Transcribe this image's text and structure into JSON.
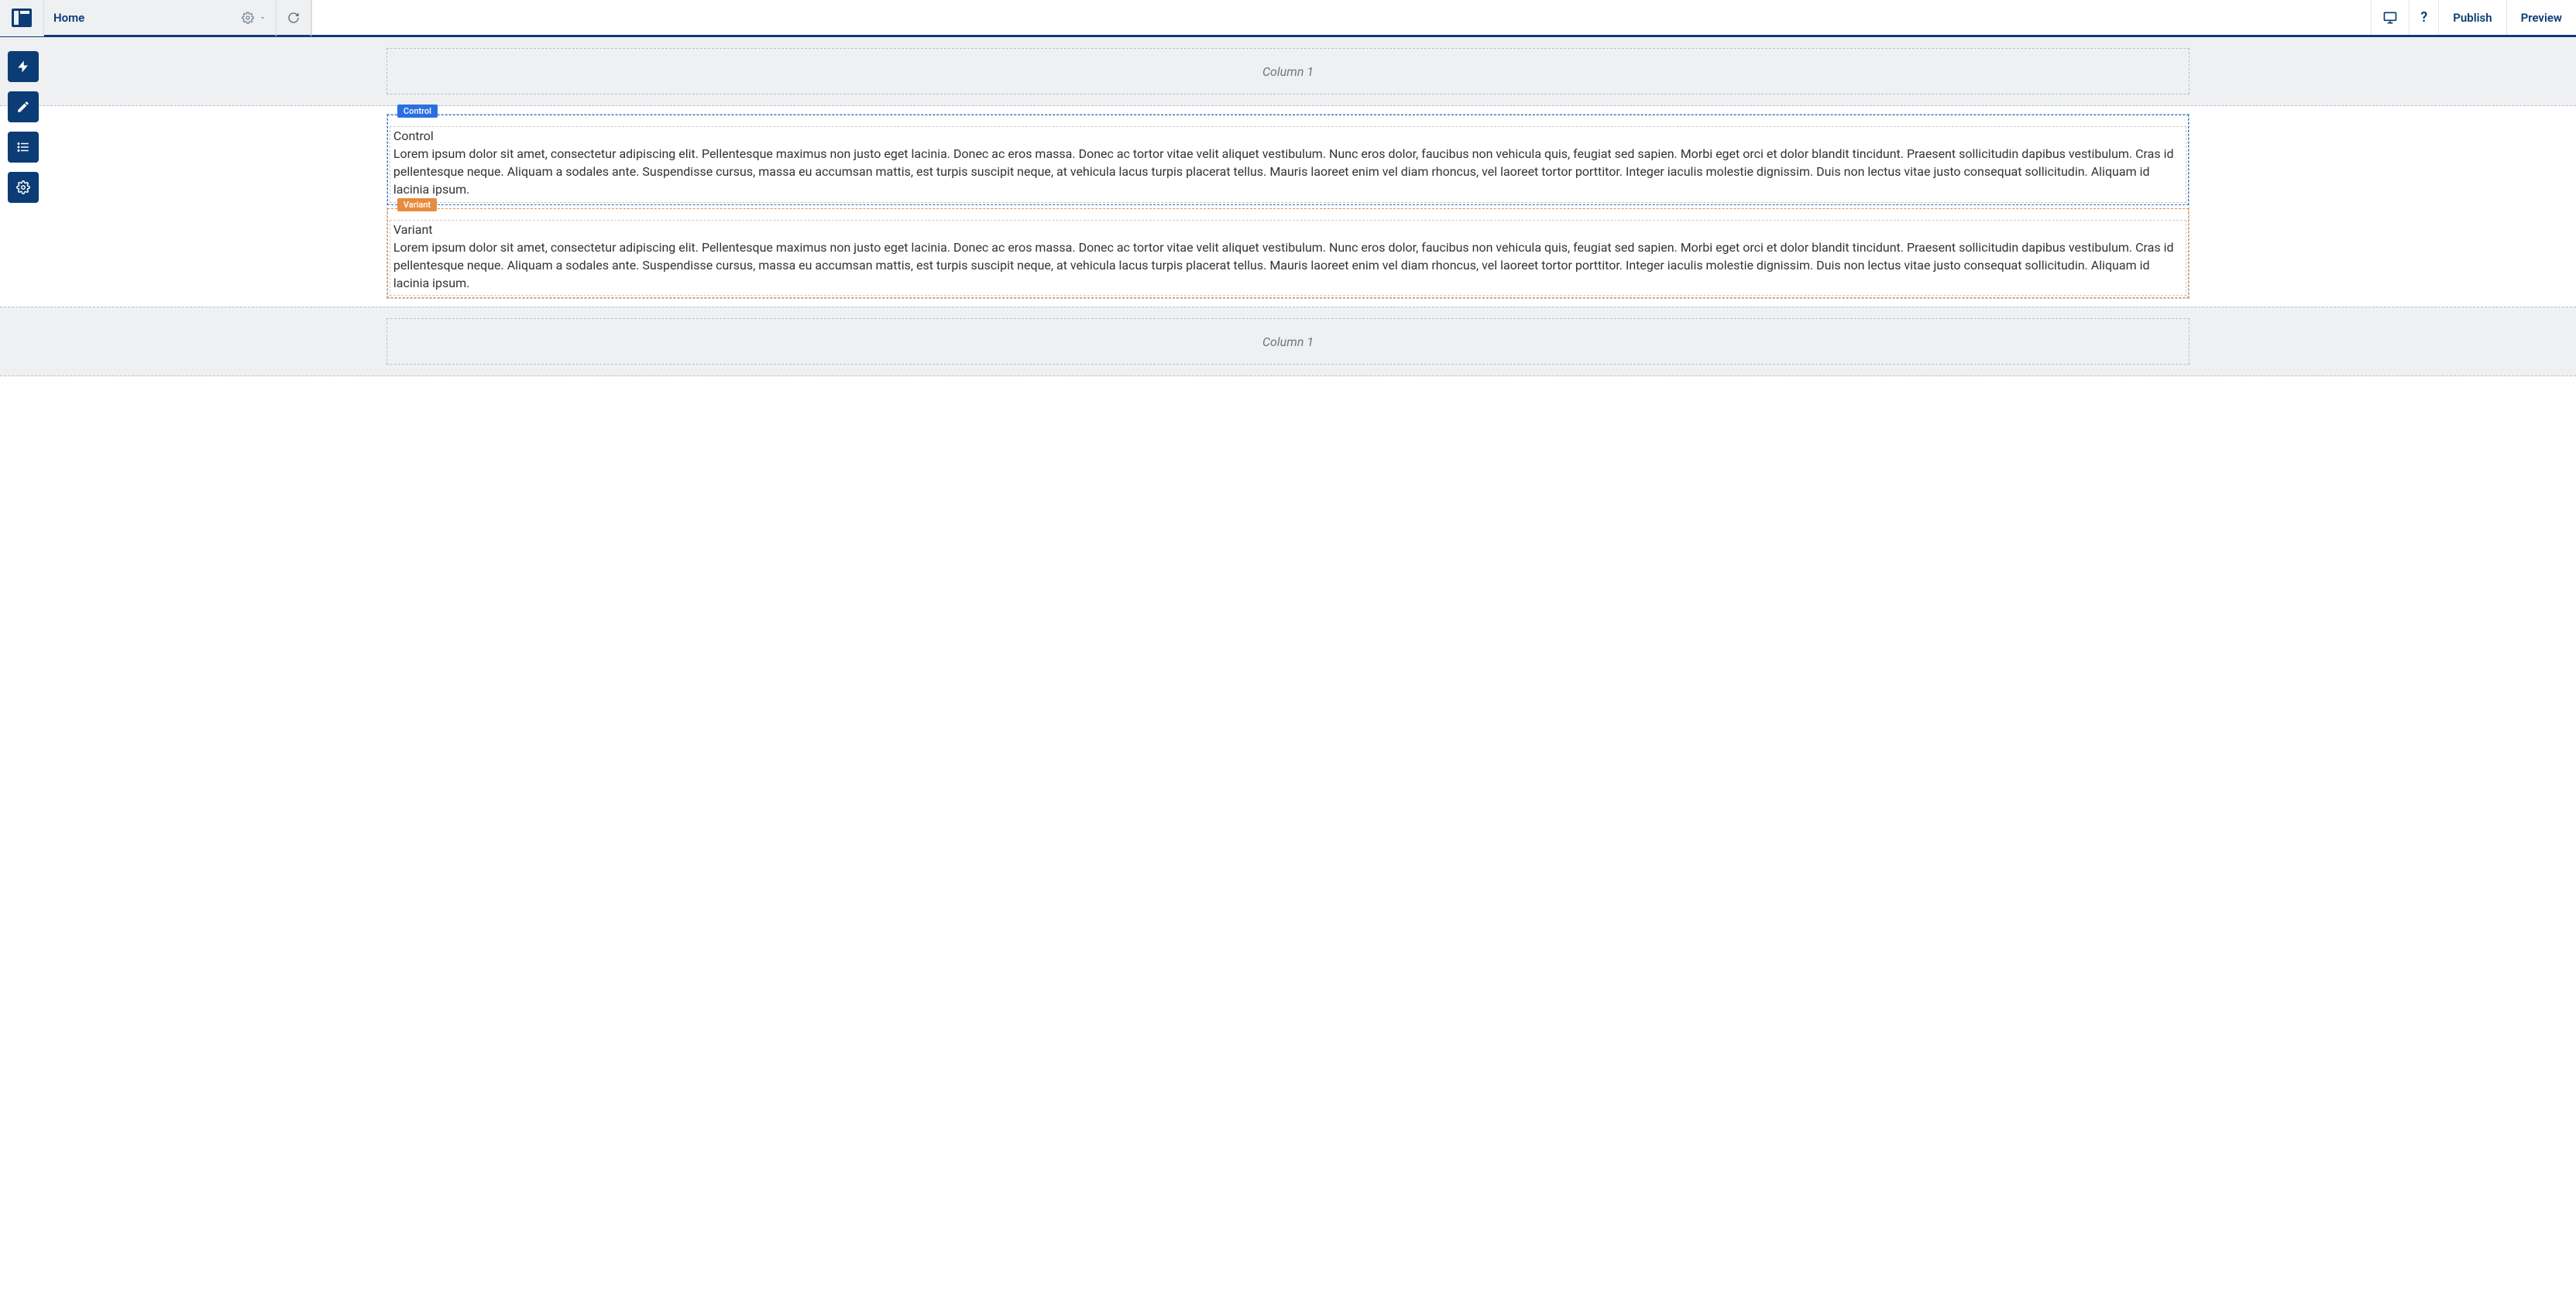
{
  "topbar": {
    "site_name": "Home",
    "publish_label": "Publish",
    "preview_label": "Preview"
  },
  "placeholders": {
    "column_top": "Column 1",
    "column_bottom": "Column 1"
  },
  "experiment": {
    "control": {
      "tag": "Control",
      "title": "Control",
      "body": "Lorem ipsum dolor sit amet, consectetur adipiscing elit. Pellentesque maximus non justo eget lacinia. Donec ac eros massa. Donec ac tortor vitae velit aliquet vestibulum. Nunc eros dolor, faucibus non vehicula quis, feugiat sed sapien. Morbi eget orci et dolor blandit tincidunt. Praesent sollicitudin dapibus vestibulum. Cras id pellentesque neque. Aliquam a sodales ante. Suspendisse cursus, massa eu accumsan mattis, est turpis suscipit neque, at vehicula lacus turpis placerat tellus. Mauris laoreet enim vel diam rhoncus, vel laoreet tortor porttitor. Integer iaculis molestie dignissim. Duis non lectus vitae justo consequat sollicitudin. Aliquam id lacinia ipsum."
    },
    "variant": {
      "tag": "Variant",
      "title": "Variant",
      "body": "Lorem ipsum dolor sit amet, consectetur adipiscing elit. Pellentesque maximus non justo eget lacinia. Donec ac eros massa. Donec ac tortor vitae velit aliquet vestibulum. Nunc eros dolor, faucibus non vehicula quis, feugiat sed sapien. Morbi eget orci et dolor blandit tincidunt. Praesent sollicitudin dapibus vestibulum. Cras id pellentesque neque. Aliquam a sodales ante. Suspendisse cursus, massa eu accumsan mattis, est turpis suscipit neque, at vehicula lacus turpis placerat tellus. Mauris laoreet enim vel diam rhoncus, vel laoreet tortor porttitor. Integer iaculis molestie dignissim. Duis non lectus vitae justo consequat sollicitudin. Aliquam id lacinia ipsum."
    }
  }
}
